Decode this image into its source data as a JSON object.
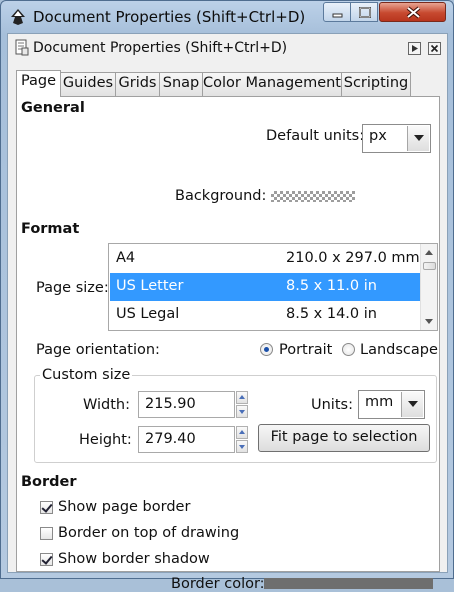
{
  "window": {
    "title": "Document Properties (Shift+Ctrl+D)",
    "controls": [
      "minimize",
      "maximize",
      "close"
    ]
  },
  "dock": {
    "title": "Document Properties (Shift+Ctrl+D)",
    "buttons": [
      "undock-icon",
      "close-icon"
    ]
  },
  "tabs": [
    "Page",
    "Guides",
    "Grids",
    "Snap",
    "Color Management",
    "Scripting"
  ],
  "general": {
    "heading": "General",
    "default_units_label": "Default units:",
    "default_units_value": "px",
    "background_label": "Background:"
  },
  "format": {
    "heading": "Format",
    "page_size_label": "Page size:",
    "page_sizes": [
      {
        "name": "A4",
        "dims": "210.0 x 297.0 mm"
      },
      {
        "name": "US Letter",
        "dims": "8.5 x 11.0 in"
      },
      {
        "name": "US Legal",
        "dims": "8.5 x 14.0 in"
      }
    ],
    "selected": "US Letter",
    "orientation_label": "Page orientation:",
    "portrait_label": "Portrait",
    "landscape_label": "Landscape",
    "orientation_selected": "Portrait"
  },
  "custom_size": {
    "legend": "Custom size",
    "width_label": "Width:",
    "width_value": "215.90",
    "height_label": "Height:",
    "height_value": "279.40",
    "units_label": "Units:",
    "units_value": "mm",
    "fit_button": "Fit page to selection"
  },
  "border": {
    "heading": "Border",
    "show_page_border": {
      "label": "Show page border",
      "checked": true
    },
    "border_on_top": {
      "label": "Border on top of drawing",
      "checked": false
    },
    "show_border_shadow": {
      "label": "Show border shadow",
      "checked": true
    },
    "border_color_label": "Border color:",
    "border_color": "#6e6e6e"
  }
}
